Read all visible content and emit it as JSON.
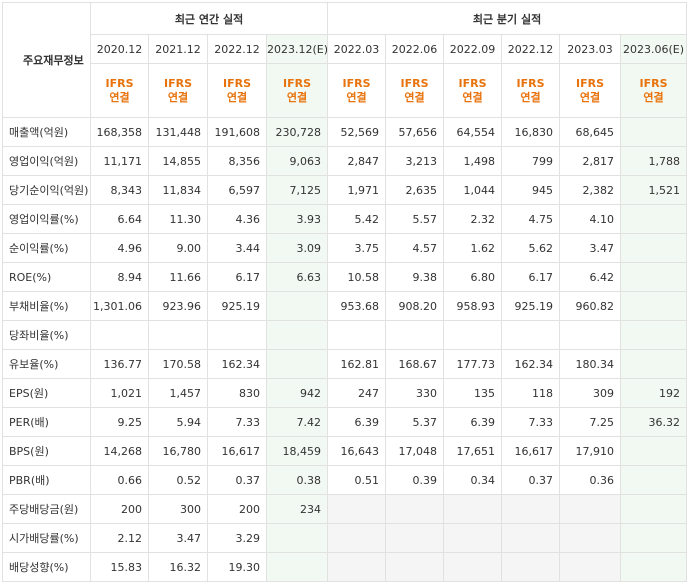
{
  "header": {
    "row_label": "주요재무정보",
    "annual_title": "최근 연간 실적",
    "quarter_title": "최근 분기 실적"
  },
  "columns": [
    {
      "period": "2020.12",
      "type": "IFRS\n연결",
      "est": false
    },
    {
      "period": "2021.12",
      "type": "IFRS\n연결",
      "est": false
    },
    {
      "period": "2022.12",
      "type": "IFRS\n연결",
      "est": false
    },
    {
      "period": "2023.12(E)",
      "type": "IFRS\n연결",
      "est": true
    },
    {
      "period": "2022.03",
      "type": "IFRS\n연결",
      "est": false
    },
    {
      "period": "2022.06",
      "type": "IFRS\n연결",
      "est": false
    },
    {
      "period": "2022.09",
      "type": "IFRS\n연결",
      "est": false
    },
    {
      "period": "2022.12",
      "type": "IFRS\n연결",
      "est": false
    },
    {
      "period": "2023.03",
      "type": "IFRS\n연결",
      "est": false
    },
    {
      "period": "2023.06(E)",
      "type": "IFRS\n연결",
      "est": true
    }
  ],
  "rows": [
    {
      "label": "매출액(억원)",
      "values": [
        "168,358",
        "131,448",
        "191,608",
        "230,728",
        "52,569",
        "57,656",
        "64,554",
        "16,830",
        "68,645",
        ""
      ],
      "group_start": true
    },
    {
      "label": "영업이익(억원)",
      "values": [
        "11,171",
        "14,855",
        "8,356",
        "9,063",
        "2,847",
        "3,213",
        "1,498",
        "799",
        "2,817",
        "1,788"
      ],
      "group_start": false
    },
    {
      "label": "당기순이익(억원)",
      "values": [
        "8,343",
        "11,834",
        "6,597",
        "7,125",
        "1,971",
        "2,635",
        "1,044",
        "945",
        "2,382",
        "1,521"
      ],
      "group_start": false
    },
    {
      "label": "영업이익률(%)",
      "values": [
        "6.64",
        "11.30",
        "4.36",
        "3.93",
        "5.42",
        "5.57",
        "2.32",
        "4.75",
        "4.10",
        ""
      ],
      "group_start": true
    },
    {
      "label": "순이익률(%)",
      "values": [
        "4.96",
        "9.00",
        "3.44",
        "3.09",
        "3.75",
        "4.57",
        "1.62",
        "5.62",
        "3.47",
        ""
      ],
      "group_start": false
    },
    {
      "label": "ROE(%)",
      "values": [
        "8.94",
        "11.66",
        "6.17",
        "6.63",
        "10.58",
        "9.38",
        "6.80",
        "6.17",
        "6.42",
        ""
      ],
      "group_start": false
    },
    {
      "label": "부채비율(%)",
      "values": [
        "1,301.06",
        "923.96",
        "925.19",
        "",
        "953.68",
        "908.20",
        "958.93",
        "925.19",
        "960.82",
        ""
      ],
      "group_start": true
    },
    {
      "label": "당좌비율(%)",
      "values": [
        "",
        "",
        "",
        "",
        "",
        "",
        "",
        "",
        "",
        ""
      ],
      "group_start": false
    },
    {
      "label": "유보율(%)",
      "values": [
        "136.77",
        "170.58",
        "162.34",
        "",
        "162.81",
        "168.67",
        "177.73",
        "162.34",
        "180.34",
        ""
      ],
      "group_start": false
    },
    {
      "label": "EPS(원)",
      "values": [
        "1,021",
        "1,457",
        "830",
        "942",
        "247",
        "330",
        "135",
        "118",
        "309",
        "192"
      ],
      "group_start": true
    },
    {
      "label": "PER(배)",
      "values": [
        "9.25",
        "5.94",
        "7.33",
        "7.42",
        "6.39",
        "5.37",
        "6.39",
        "7.33",
        "7.25",
        "36.32"
      ],
      "group_start": false
    },
    {
      "label": "BPS(원)",
      "values": [
        "14,268",
        "16,780",
        "16,617",
        "18,459",
        "16,643",
        "17,048",
        "17,651",
        "16,617",
        "17,910",
        ""
      ],
      "group_start": false
    },
    {
      "label": "PBR(배)",
      "values": [
        "0.66",
        "0.52",
        "0.37",
        "0.38",
        "0.51",
        "0.39",
        "0.34",
        "0.37",
        "0.36",
        ""
      ],
      "group_start": false
    },
    {
      "label": "주당배당금(원)",
      "values": [
        "200",
        "300",
        "200",
        "234",
        null,
        null,
        null,
        null,
        null,
        null
      ],
      "group_start": true
    },
    {
      "label": "시가배당률(%)",
      "values": [
        "2.12",
        "3.47",
        "3.29",
        "",
        null,
        null,
        null,
        null,
        null,
        null
      ],
      "group_start": false
    },
    {
      "label": "배당성향(%)",
      "values": [
        "15.83",
        "16.32",
        "19.30",
        "",
        null,
        null,
        null,
        null,
        null,
        null
      ],
      "group_start": false
    }
  ]
}
